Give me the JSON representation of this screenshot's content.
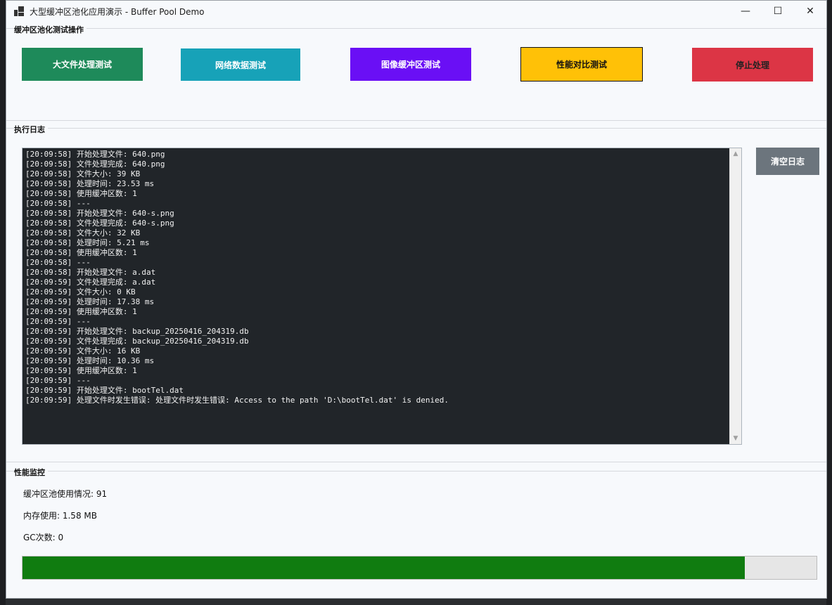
{
  "window": {
    "title": "大型缓冲区池化应用演示 - Buffer Pool Demo",
    "controls": {
      "minimize": "—",
      "maximize": "☐",
      "close": "✕"
    }
  },
  "ops_group": {
    "label": "缓冲区池化测试操作",
    "buttons": {
      "large_file": "大文件处理测试",
      "network": "网络数据测试",
      "image": "图像缓冲区测试",
      "perf": "性能对比测试",
      "stop": "停止处理"
    }
  },
  "log_group": {
    "label": "执行日志",
    "clear_button": "清空日志",
    "lines": [
      "[20:09:58] 开始处理文件: 640.png",
      "[20:09:58] 文件处理完成: 640.png",
      "[20:09:58] 文件大小: 39 KB",
      "[20:09:58] 处理时间: 23.53 ms",
      "[20:09:58] 使用缓冲区数: 1",
      "[20:09:58] ---",
      "[20:09:58] 开始处理文件: 640-s.png",
      "[20:09:58] 文件处理完成: 640-s.png",
      "[20:09:58] 文件大小: 32 KB",
      "[20:09:58] 处理时间: 5.21 ms",
      "[20:09:58] 使用缓冲区数: 1",
      "[20:09:58] ---",
      "[20:09:58] 开始处理文件: a.dat",
      "[20:09:59] 文件处理完成: a.dat",
      "[20:09:59] 文件大小: 0 KB",
      "[20:09:59] 处理时间: 17.38 ms",
      "[20:09:59] 使用缓冲区数: 1",
      "[20:09:59] ---",
      "[20:09:59] 开始处理文件: backup_20250416_204319.db",
      "[20:09:59] 文件处理完成: backup_20250416_204319.db",
      "[20:09:59] 文件大小: 16 KB",
      "[20:09:59] 处理时间: 10.36 ms",
      "[20:09:59] 使用缓冲区数: 1",
      "[20:09:59] ---",
      "[20:09:59] 开始处理文件: bootTel.dat",
      "[20:09:59] 处理文件时发生错误: 处理文件时发生错误: Access to the path 'D:\\bootTel.dat' is denied."
    ]
  },
  "perf_group": {
    "label": "性能监控",
    "pool_usage": "缓冲区池使用情况: 91",
    "memory": "内存使用: 1.58 MB",
    "gc": "GC次数: 0",
    "progress_percent": 91
  },
  "colors": {
    "green_btn": "#1e8a5a",
    "teal_btn": "#17a2b8",
    "purple_btn": "#6a0ff5",
    "yellow_btn": "#ffc107",
    "red_btn": "#dc3545",
    "gray_btn": "#6c757d",
    "progress_fill": "#107c10"
  }
}
